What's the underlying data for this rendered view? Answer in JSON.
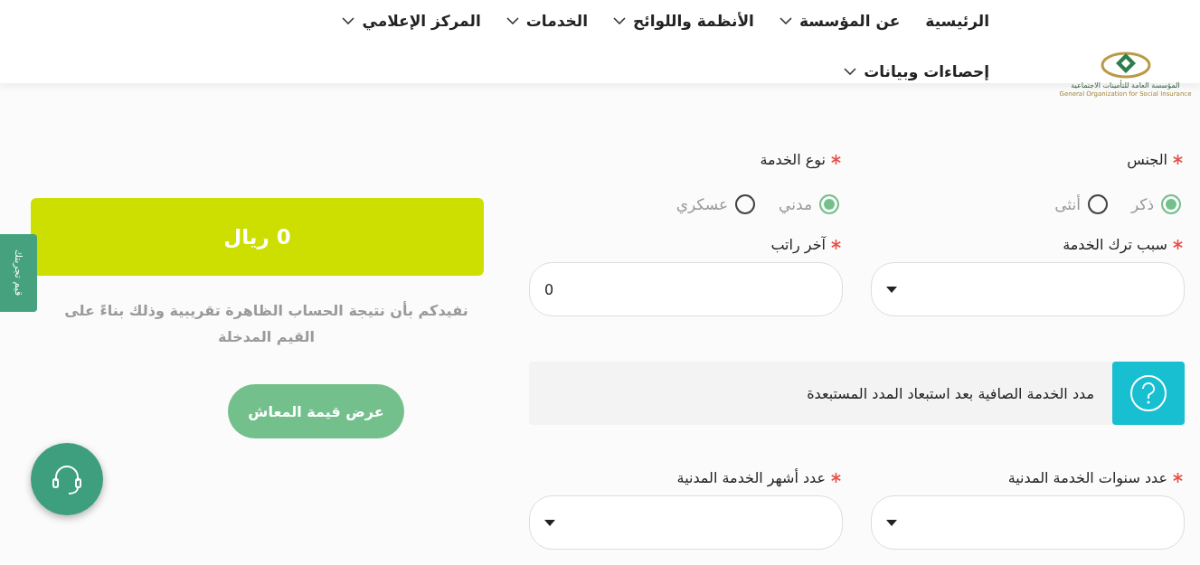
{
  "header": {
    "logo": {
      "arabic": "المؤسسة العامة للتأمينات الاجتماعية",
      "english": "General Organization for Social Insurance"
    },
    "nav": [
      {
        "label": "الرئيسية",
        "has_menu": false
      },
      {
        "label": "عن المؤسسة",
        "has_menu": true
      },
      {
        "label": "الأنظمة واللوائح",
        "has_menu": true
      },
      {
        "label": "الخدمات",
        "has_menu": true
      },
      {
        "label": "المركز الإعلامي",
        "has_menu": true
      },
      {
        "label": "إحصاءات وبيانات",
        "has_menu": true
      }
    ]
  },
  "form": {
    "rows": [
      {
        "fields": [
          {
            "kind": "radio",
            "label": "الجنس",
            "required": true,
            "options": [
              {
                "label": "ذكر",
                "selected": true
              },
              {
                "label": "أنثى",
                "selected": false
              }
            ]
          },
          {
            "kind": "radio",
            "label": "نوع الخدمة",
            "required": true,
            "options": [
              {
                "label": "مدني",
                "selected": true
              },
              {
                "label": "عسكري",
                "selected": false
              }
            ]
          }
        ]
      },
      {
        "fields": [
          {
            "kind": "select",
            "label": "سبب ترك الخدمة",
            "required": true
          },
          {
            "kind": "input",
            "label": "آخر راتب",
            "required": true,
            "value": "0"
          }
        ]
      },
      {
        "kind": "info",
        "text": "مدد الخدمة الصافية بعد استبعاد المدد المستبعدة"
      },
      {
        "fields": [
          {
            "kind": "select",
            "label": "عدد سنوات الخدمة المدنية",
            "required": true
          },
          {
            "kind": "select",
            "label": "عدد أشهر الخدمة المدنية",
            "required": true
          }
        ]
      }
    ]
  },
  "result": {
    "amount": "0 ريال",
    "note": "نفيدكم بأن نتيجة الحساب الظاهرة تقريبية وذلك بناءً على القيم المدخلة",
    "button": "عرض قيمة المعاش"
  },
  "feedback_tab": "قيم تجربتك"
}
